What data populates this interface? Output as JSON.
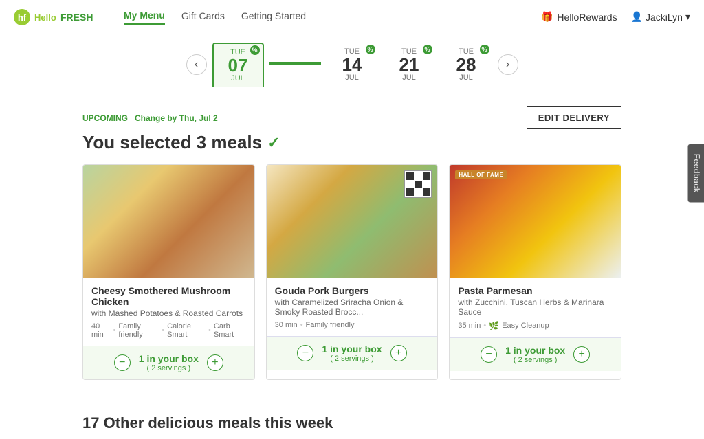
{
  "brand": {
    "name": "HelloFresh",
    "hello": "Hello",
    "fresh": "FRESH"
  },
  "nav": {
    "links": [
      {
        "id": "my-menu",
        "label": "My Menu",
        "active": true
      },
      {
        "id": "gift-cards",
        "label": "Gift Cards",
        "active": false
      },
      {
        "id": "getting-started",
        "label": "Getting Started",
        "active": false
      }
    ],
    "hello_rewards_label": "HelloRewards",
    "user_name": "JackiLyn",
    "chevron": "▾"
  },
  "date_picker": {
    "prev_label": "‹",
    "next_label": "›",
    "dates": [
      {
        "id": "jul-07",
        "day": "TUE",
        "num": "07",
        "month": "JUL",
        "active": true,
        "badge": "%"
      },
      {
        "id": "jul-14",
        "day": "TUE",
        "num": "14",
        "month": "JUL",
        "active": false,
        "badge": "%"
      },
      {
        "id": "jul-21",
        "day": "TUE",
        "num": "21",
        "month": "JUL",
        "active": false,
        "badge": "%"
      },
      {
        "id": "jul-28",
        "day": "TUE",
        "num": "28",
        "month": "JUL",
        "active": false,
        "badge": "%"
      }
    ]
  },
  "delivery": {
    "upcoming_label": "UPCOMING",
    "change_label": "Change by Thu, Jul 2",
    "selected_meals_text": "You selected 3 meals",
    "check_symbol": "✓",
    "edit_button_label": "EDIT DELIVERY"
  },
  "meals": [
    {
      "id": "meal-1",
      "name": "Cheesy Smothered Mushroom Chicken",
      "description": "with Mashed Potatoes & Roasted Carrots",
      "time": "40 min",
      "tags": [
        "Family friendly",
        "Calorie Smart",
        "Carb Smart"
      ],
      "hall_of_fame": false,
      "eco": false,
      "quantity": 1,
      "servings": 2,
      "box_text": "1 in your box",
      "servings_text": "( 2 servings )",
      "img_class": "img-chicken"
    },
    {
      "id": "meal-2",
      "name": "Gouda Pork Burgers",
      "description": "with Caramelized Sriracha Onion & Smoky Roasted Brocc...",
      "time": "30 min",
      "tags": [
        "Family friendly"
      ],
      "hall_of_fame": false,
      "eco": false,
      "quantity": 1,
      "servings": 2,
      "box_text": "1 in your box",
      "servings_text": "( 2 servings )",
      "img_class": "img-burger"
    },
    {
      "id": "meal-3",
      "name": "Pasta Parmesan",
      "description": "with Zucchini, Tuscan Herbs & Marinara Sauce",
      "time": "35 min",
      "tags": [
        "Easy Cleanup"
      ],
      "hall_of_fame": true,
      "hall_of_fame_label": "HALL OF FAME",
      "eco": true,
      "quantity": 1,
      "servings": 2,
      "box_text": "1 in your box",
      "servings_text": "( 2 servings )",
      "img_class": "img-pasta"
    }
  ],
  "other_meals": {
    "title": "17 Other delicious meals this week"
  },
  "feedback": {
    "label": "Feedback"
  }
}
